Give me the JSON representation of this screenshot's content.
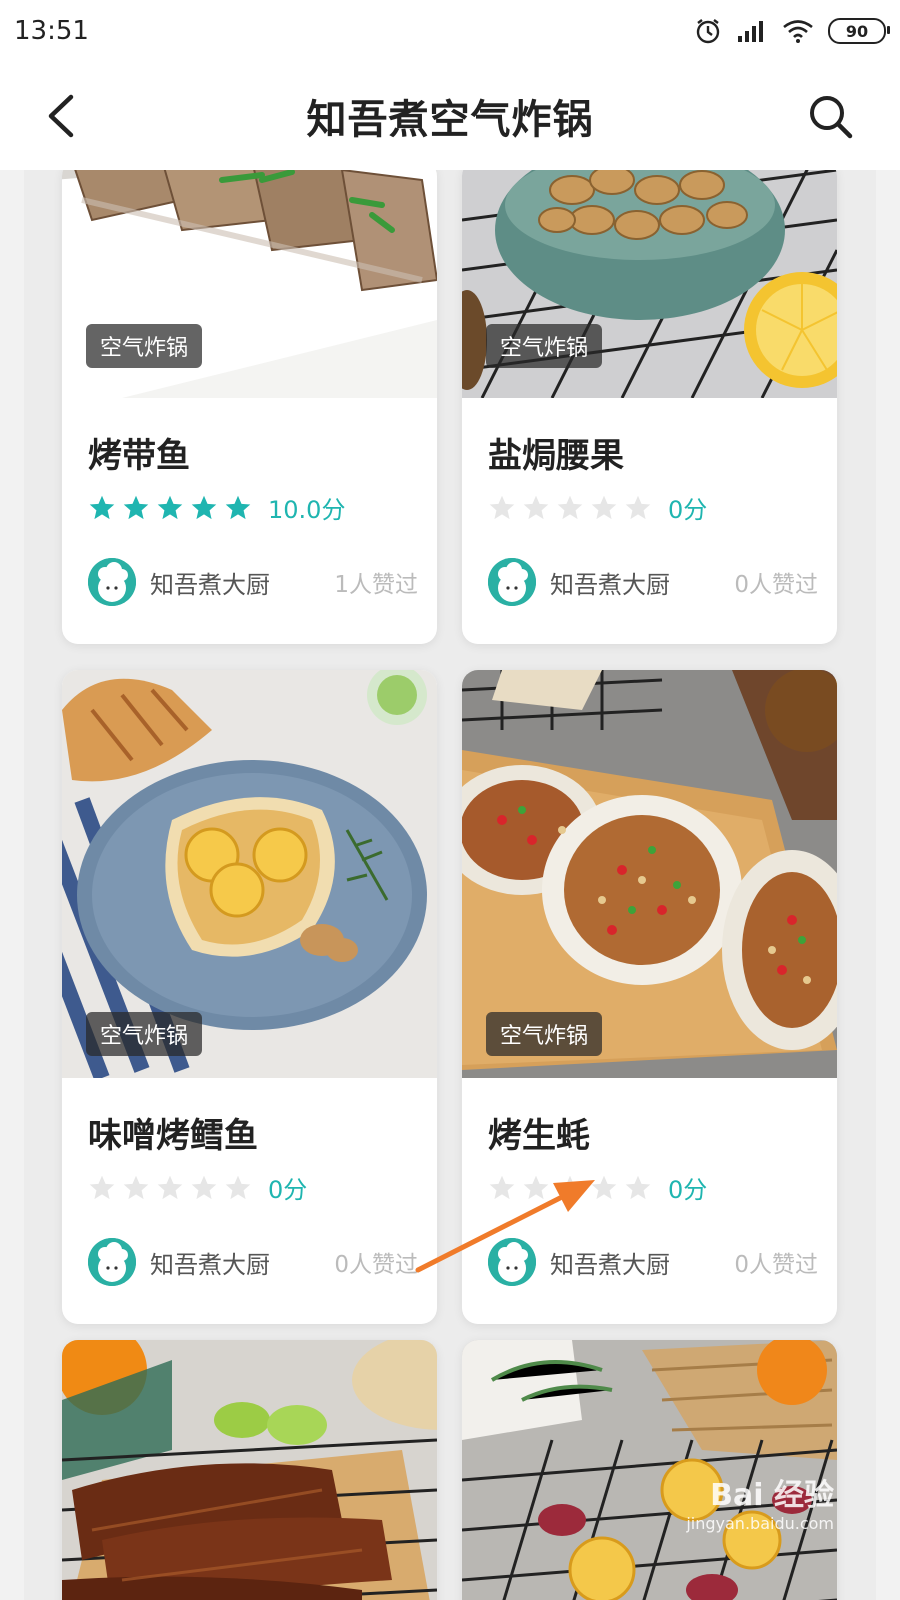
{
  "status_bar": {
    "time": "13:51",
    "battery": "90"
  },
  "header": {
    "title": "知吾煮空气炸锅"
  },
  "colors": {
    "accent": "#1fb5b0",
    "star_empty": "#e6e6e6"
  },
  "cards": [
    {
      "tag": "空气炸锅",
      "title": "烤带鱼",
      "score": "10.0分",
      "stars": 5,
      "author": "知吾煮大厨",
      "likes": "1人赞过"
    },
    {
      "tag": "空气炸锅",
      "title": "盐焗腰果",
      "score": "0分",
      "stars": 0,
      "author": "知吾煮大厨",
      "likes": "0人赞过"
    },
    {
      "tag": "空气炸锅",
      "title": "味噌烤鳕鱼",
      "score": "0分",
      "stars": 0,
      "author": "知吾煮大厨",
      "likes": "0人赞过"
    },
    {
      "tag": "空气炸锅",
      "title": "烤生蚝",
      "score": "0分",
      "stars": 0,
      "author": "知吾煮大厨",
      "likes": "0人赞过"
    }
  ],
  "watermark": {
    "brand": "Bai 经验",
    "url": "jingyan.baidu.com"
  }
}
